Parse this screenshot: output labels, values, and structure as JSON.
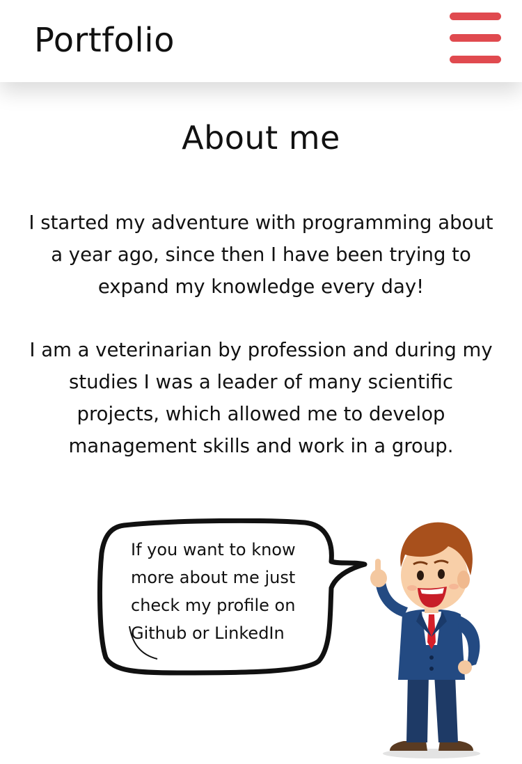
{
  "header": {
    "brand": "Portfolio",
    "menu_icon": "hamburger-menu-icon"
  },
  "about": {
    "title": "About me",
    "paragraph_1": "I started my adventure with programming about a year ago, since then I have been trying to expand my knowledge every day!",
    "paragraph_2": "I am a veterinarian by profession and during my studies I was a leader of many scientific projects, which allowed me to develop management skills and work in a group."
  },
  "speech_bubble": {
    "text": "If you want to know more about me just check my profile on Github or LinkedIn"
  },
  "colors": {
    "accent": "#e04a4f",
    "text": "#111111",
    "background": "#ffffff"
  }
}
